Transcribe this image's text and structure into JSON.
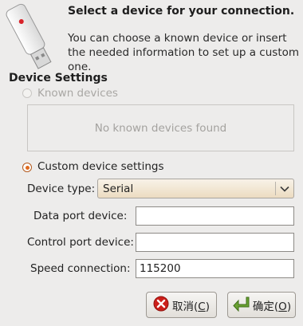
{
  "header": {
    "title": "Select a device for your connection.",
    "description": "You can choose a known device or insert the needed information to set up a custom one."
  },
  "device_settings": {
    "title": "Device Settings",
    "known_devices_label": "Known devices",
    "known_devices_empty": "No known devices found",
    "custom_label": "Custom device settings"
  },
  "form": {
    "device_type_label": "Device type:",
    "device_type_value": "Serial",
    "data_port_label": "Data port device:",
    "data_port_value": "",
    "control_port_label": "Control port device:",
    "control_port_value": "",
    "speed_label": "Speed connection:",
    "speed_value": "115200"
  },
  "buttons": {
    "cancel_text": "取消(",
    "cancel_mnemonic": "C",
    "cancel_close": ")",
    "ok_text": "确定(",
    "ok_mnemonic": "O",
    "ok_close": ")"
  },
  "icons": {
    "header": "usb-modem-icon",
    "cancel": "cancel-icon",
    "ok": "enter-arrow-icon",
    "dropdown": "chevron-down-icon"
  },
  "colors": {
    "window_bg": "#edeceb",
    "accent_radio": "#e06a1e",
    "cancel_icon": "#cc1f1a",
    "ok_icon": "#6aa132"
  }
}
